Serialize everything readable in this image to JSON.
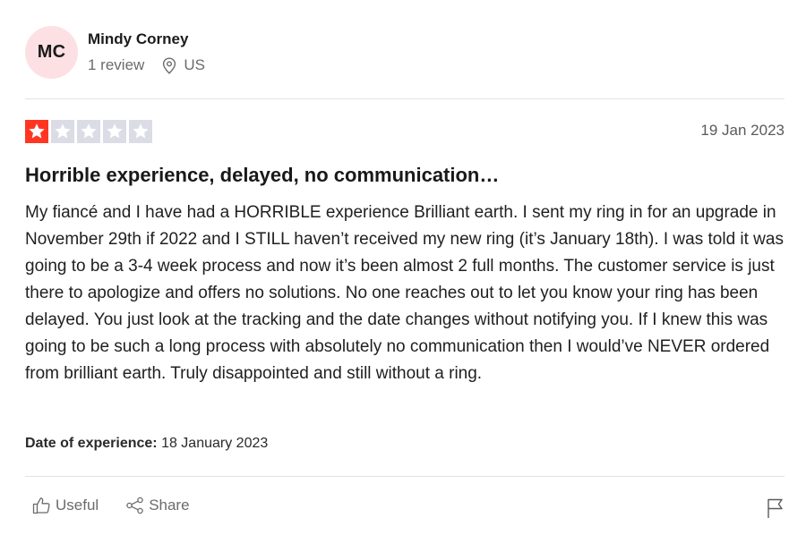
{
  "consumer": {
    "initials": "MC",
    "name": "Mindy Corney",
    "review_count": "1 review",
    "location": "US",
    "avatar_color": "#fde0e3"
  },
  "review": {
    "rating": 1,
    "max_rating": 5,
    "star_filled_color": "#ff3722",
    "star_empty_color": "#dcdce6",
    "date": "19 Jan 2023",
    "title": "Horrible experience, delayed, no communication…",
    "body": "My fiancé and I have had a HORRIBLE experience Brilliant earth. I sent my ring in for an upgrade in November 29th if 2022 and I STILL haven’t received my new ring (it’s January 18th). I was told it was going to be a 3-4 week process and now it’s been almost 2 full months. The customer service is just there to apologize and offers no solutions. No one reaches out to let you know your ring has been delayed. You just look at the tracking and the date changes without notifying you. If I knew this was going to be such a long process with absolutely no communication then I would’ve NEVER ordered from brilliant earth. Truly disappointed and still without a ring.",
    "experience_label": "Date of experience:",
    "experience_date": "18 January 2023"
  },
  "actions": {
    "useful_label": "Useful",
    "share_label": "Share",
    "useful_icon": "thumbs-up-icon",
    "share_icon": "share-icon",
    "flag_icon": "flag-icon"
  }
}
